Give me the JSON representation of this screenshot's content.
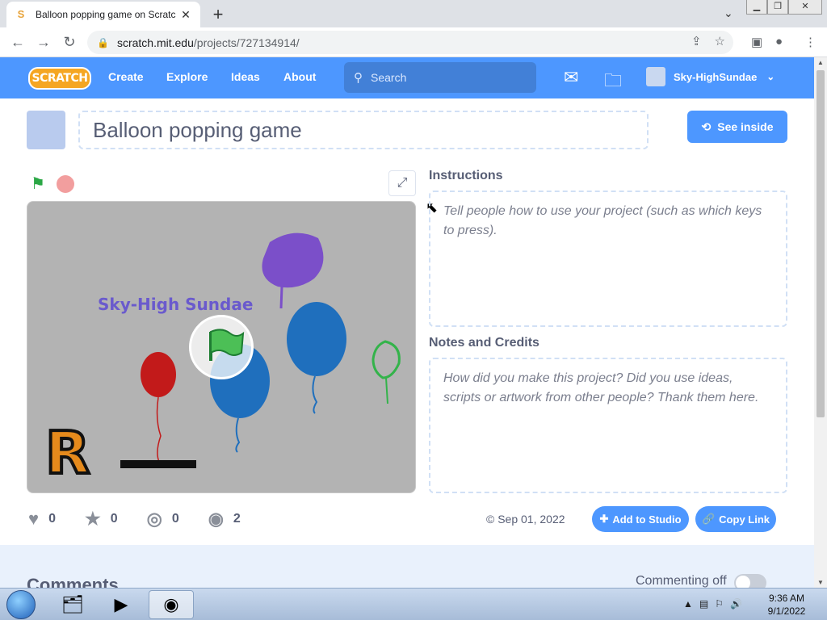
{
  "browser": {
    "tab_title": "Balloon popping game on Scratc",
    "tab_favicon": "S",
    "url_host": "scratch.mit.edu",
    "url_path": "/projects/727134914/"
  },
  "nav": {
    "logo": "SCRATCH",
    "links": [
      "Create",
      "Explore",
      "Ideas",
      "About"
    ],
    "search_placeholder": "Search",
    "username": "Sky-HighSundae"
  },
  "project": {
    "title": "Balloon popping game",
    "see_inside_label": "See inside",
    "stage_text": "Sky-High Sundae",
    "instructions_heading": "Instructions",
    "instructions_placeholder": "Tell people how to use your project (such as which keys to press).",
    "notes_heading": "Notes and Credits",
    "notes_placeholder": "How did you make this project? Did you use ideas, scripts or artwork from other people? Thank them here.",
    "stats": {
      "loves": "0",
      "favorites": "0",
      "remixes": "0",
      "views": "2"
    },
    "date": "Sep 01, 2022",
    "add_to_studio_label": "Add to Studio",
    "copy_link_label": "Copy Link"
  },
  "comments": {
    "heading": "Comments",
    "commenting_status": "Commenting off"
  },
  "taskbar": {
    "time": "9:36 AM",
    "date": "9/1/2022"
  },
  "colors": {
    "scratch_blue": "#4d97ff",
    "logo_orange": "#f5a623",
    "stage_bg": "#b3b3b3"
  }
}
